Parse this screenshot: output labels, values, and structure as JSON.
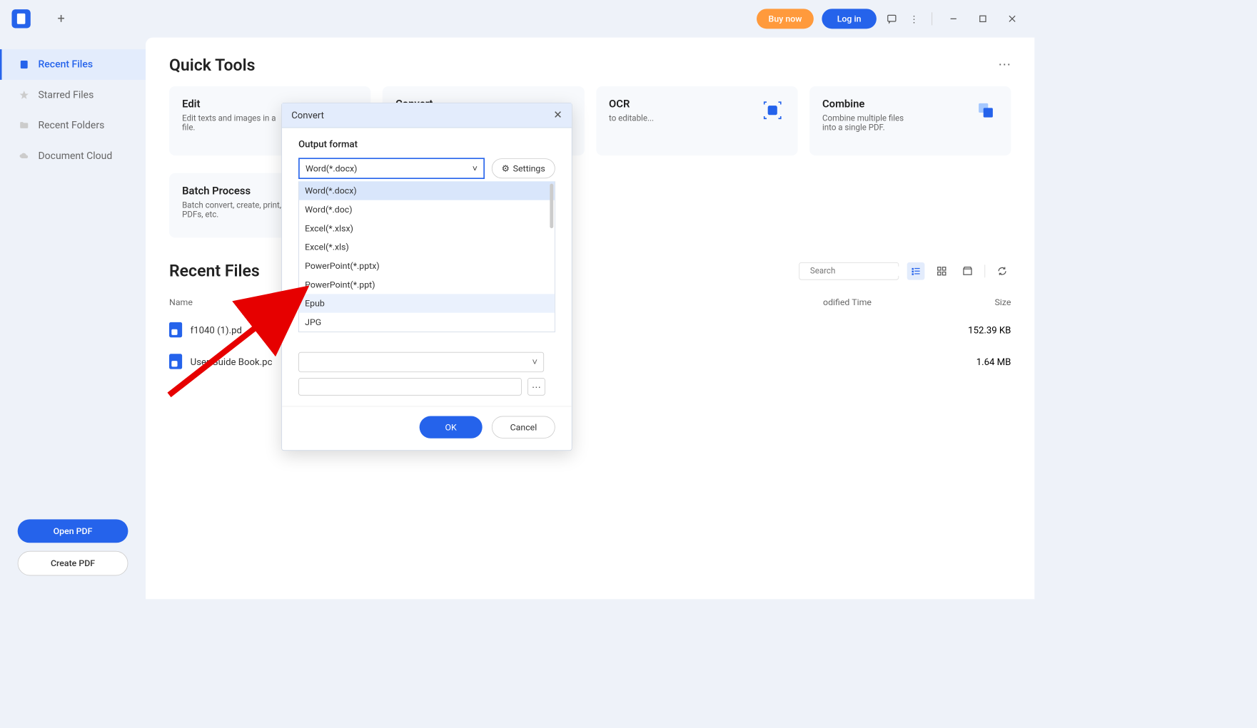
{
  "titlebar": {
    "buy_label": "Buy now",
    "login_label": "Log in"
  },
  "sidebar": {
    "items": [
      {
        "label": "Recent Files"
      },
      {
        "label": "Starred Files"
      },
      {
        "label": "Recent Folders"
      },
      {
        "label": "Document Cloud"
      }
    ],
    "open_label": "Open PDF",
    "create_label": "Create PDF"
  },
  "quick_tools": {
    "title": "Quick Tools",
    "cards": [
      {
        "title": "Edit",
        "desc": "Edit texts and images in a file."
      },
      {
        "title": "Convert",
        "desc": ""
      },
      {
        "title": "OCR",
        "desc": "to editable..."
      },
      {
        "title": "Combine",
        "desc": "Combine multiple files into a single PDF."
      }
    ],
    "batch": {
      "title": "Batch Process",
      "desc": "Batch convert, create, print, OCR PDFs, etc."
    }
  },
  "recent_files": {
    "title": "Recent Files",
    "search_placeholder": "Search",
    "headers": {
      "name": "Name",
      "time": "odified Time",
      "size": "Size"
    },
    "rows": [
      {
        "name": "f1040 (1).pd",
        "size": "152.39 KB"
      },
      {
        "name": "User Guide Book.pc",
        "size": "1.64 MB"
      }
    ]
  },
  "modal": {
    "title": "Convert",
    "output_label": "Output format",
    "selected": "Word(*.docx)",
    "settings_label": "Settings",
    "options": [
      "Word(*.docx)",
      "Word(*.doc)",
      "Excel(*.xlsx)",
      "Excel(*.xls)",
      "PowerPoint(*.pptx)",
      "PowerPoint(*.ppt)",
      "Epub",
      "JPG"
    ],
    "ok_label": "OK",
    "cancel_label": "Cancel"
  }
}
